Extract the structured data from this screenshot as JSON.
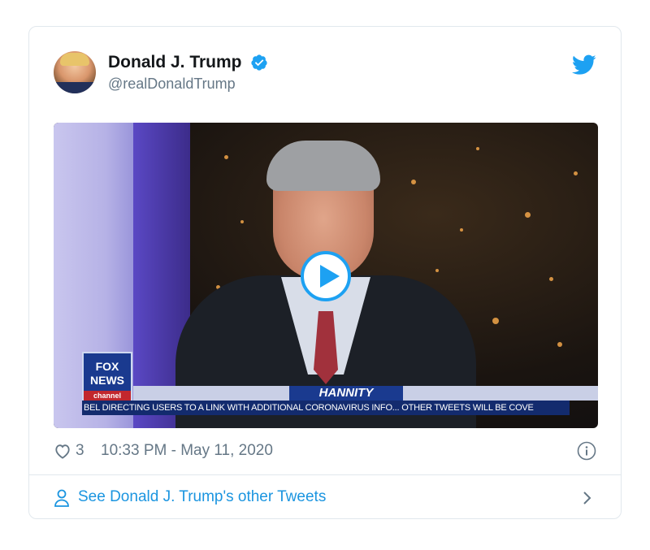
{
  "tweet": {
    "display_name": "Donald J. Trump",
    "handle": "@realDonaldTrump",
    "likes": "3",
    "timestamp": "10:33 PM - May 11, 2020"
  },
  "media": {
    "show_name": "HANNITY",
    "ticker_text": "BEL DIRECTING USERS TO A LINK WITH ADDITIONAL CORONAVIRUS INFO...   OTHER TWEETS WILL BE COVE",
    "logo_line1": "FOX",
    "logo_line2": "NEWS",
    "logo_line3": "channel"
  },
  "footer": {
    "link_label": "See Donald J. Trump's other Tweets"
  },
  "colors": {
    "accent": "#1da1f2",
    "link": "#1b95e0",
    "muted": "#657786",
    "border": "#e1e8ed"
  },
  "icons": [
    "verified-icon",
    "twitter-bird-icon",
    "play-icon",
    "heart-icon",
    "info-icon",
    "person-icon",
    "chevron-right-icon"
  ]
}
